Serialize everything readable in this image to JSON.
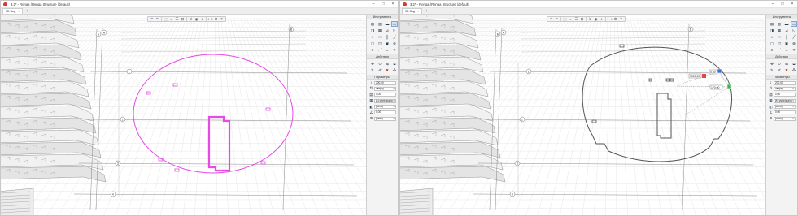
{
  "colors": {
    "accent": "#e44ce4",
    "geometry": "#555555",
    "grid": "#e7e7e7",
    "snap_blue": "#3a6fd4",
    "snap_green": "#39b54a",
    "snap_red": "#e04848"
  },
  "windows": [
    {
      "title": "3.2* - Renga (Renga Structure (default)",
      "tab_label": "3D Вид",
      "tab_close": "×",
      "tab_add": "+",
      "controls": [
        "–",
        "□",
        "×"
      ],
      "toolbar_icons": [
        "undo-icon",
        "redo-icon",
        "view-cube-icon",
        "visual-style-icon",
        "layers-icon",
        "section-icon",
        "filter-icon",
        "camera-icon",
        "select-icon",
        "measure-icon",
        "settings-icon",
        "help-icon"
      ],
      "panel": {
        "tools_header": "Инструменты",
        "tool_icons": [
          "wall-icon",
          "column-icon",
          "beam-icon",
          "slab-icon",
          "door-icon",
          "window-icon",
          "stair-icon",
          "ramp-icon",
          "roof-icon",
          "opening-icon",
          "railing-icon",
          "line-icon",
          "room-icon",
          "equipment-icon",
          "foundation-icon",
          "axis-icon",
          "level-icon",
          "rebar-icon",
          "dimension-icon",
          "text-icon"
        ],
        "actions_header": "Действия",
        "action_icons": [
          "move-icon",
          "rotate-icon",
          "mirror-icon",
          "copy-icon",
          "edit-icon",
          "brush-icon",
          "delete-icon",
          "array-icon"
        ],
        "params_header": "Параметры",
        "params": [
          {
            "icon": "height-icon",
            "value": "200,00",
            "dropdown": false
          },
          {
            "icon": "offset-icon",
            "value": "сверху",
            "dropdown": true
          },
          {
            "icon": "thickness-icon",
            "value": "0,00",
            "dropdown": false
          },
          {
            "icon": "material-icon",
            "value": "Из материала",
            "dropdown": true
          },
          {
            "icon": "style-icon",
            "value": "(авто)",
            "dropdown": true
          },
          {
            "icon": "angle-icon",
            "value": "0,00",
            "dropdown": false
          },
          {
            "icon": "mark-icon",
            "value": "(авто)",
            "dropdown": true
          }
        ]
      },
      "axis_labels": [
        "1",
        "2",
        "3",
        "4",
        "А",
        "Б",
        "В"
      ]
    },
    {
      "title": "3.2* - Renga (Renga Structure (default)",
      "tab_label": "3D Вид",
      "tab_close": "×",
      "tab_add": "+",
      "controls": [
        "–",
        "□",
        "×"
      ],
      "toolbar_icons": [
        "undo-icon",
        "redo-icon",
        "view-cube-icon",
        "visual-style-icon",
        "layers-icon",
        "section-icon",
        "filter-icon",
        "camera-icon",
        "select-icon",
        "measure-icon",
        "settings-icon",
        "help-icon"
      ],
      "panel": {
        "tools_header": "Инструменты",
        "tool_icons": [
          "wall-icon",
          "column-icon",
          "beam-icon",
          "slab-icon",
          "door-icon",
          "window-icon",
          "stair-icon",
          "ramp-icon",
          "roof-icon",
          "opening-icon",
          "railing-icon",
          "line-icon",
          "room-icon",
          "equipment-icon",
          "foundation-icon",
          "axis-icon",
          "level-icon",
          "rebar-icon",
          "dimension-icon",
          "text-icon"
        ],
        "actions_header": "Действия",
        "action_icons": [
          "move-icon",
          "rotate-icon",
          "mirror-icon",
          "copy-icon",
          "edit-icon",
          "brush-icon",
          "delete-icon",
          "array-icon"
        ],
        "params_header": "Параметры",
        "params": [
          {
            "icon": "height-icon",
            "value": "200,00",
            "dropdown": false
          },
          {
            "icon": "offset-icon",
            "value": "сверху",
            "dropdown": true
          },
          {
            "icon": "thickness-icon",
            "value": "0,00",
            "dropdown": false
          },
          {
            "icon": "material-icon",
            "value": "Из материала",
            "dropdown": true
          },
          {
            "icon": "style-icon",
            "value": "(авто)",
            "dropdown": true
          },
          {
            "icon": "angle-icon",
            "value": "0,00",
            "dropdown": false
          },
          {
            "icon": "mark-icon",
            "value": "(авто)",
            "dropdown": true
          }
        ]
      },
      "edit_labels": {
        "length_value": "9000,00",
        "angle_value": "0,00",
        "coordinate_value": "170,00"
      },
      "axis_labels": [
        "1",
        "2",
        "3",
        "4",
        "А",
        "Б",
        "В"
      ]
    }
  ]
}
